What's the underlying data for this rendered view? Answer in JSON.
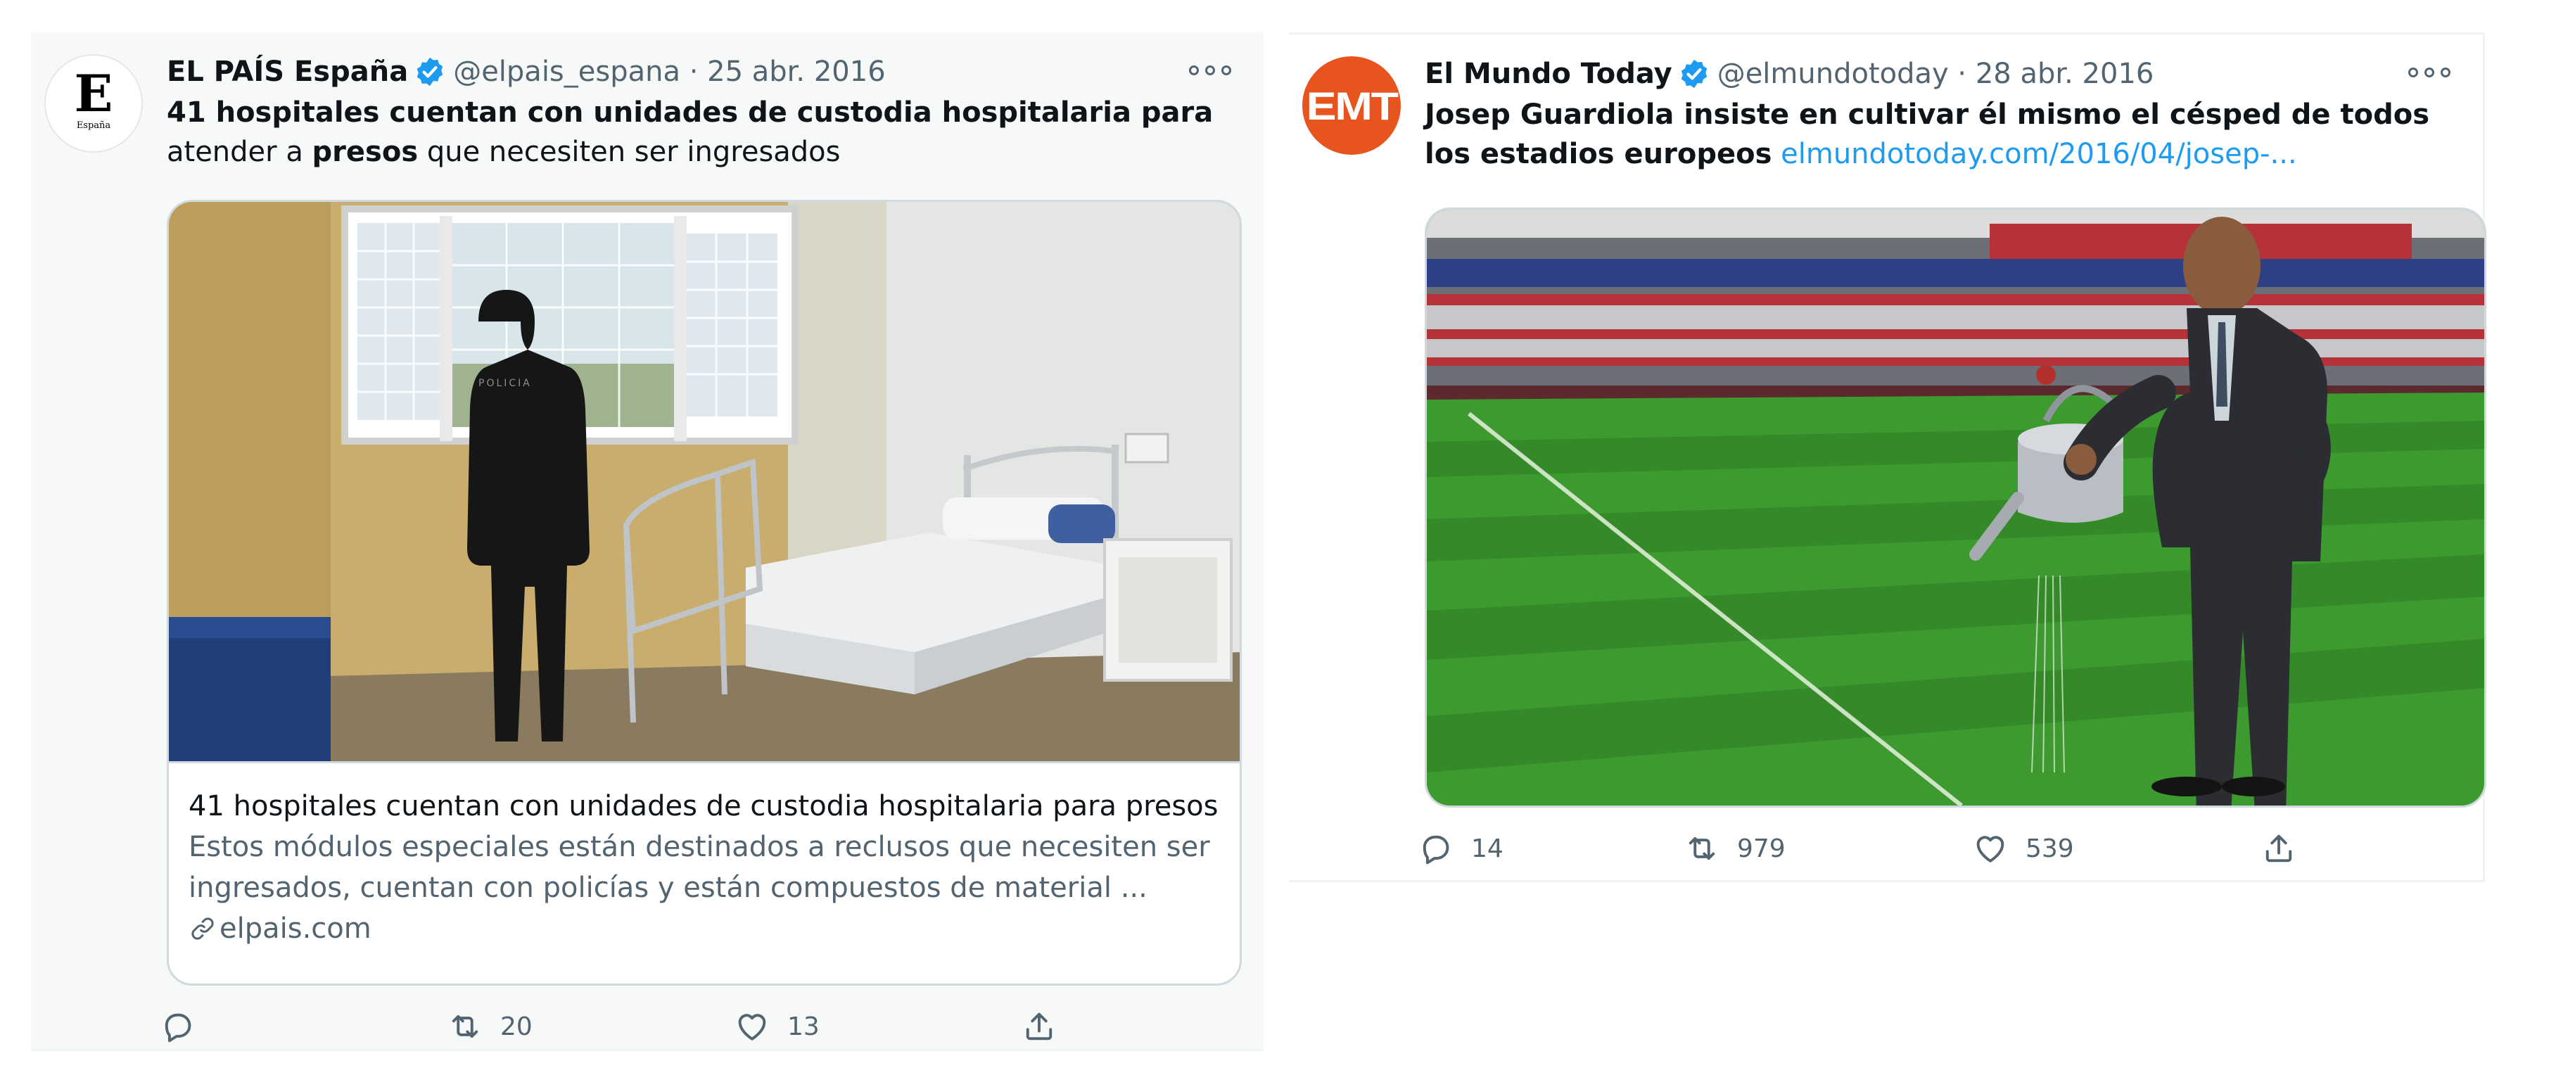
{
  "tweets": [
    {
      "author_name": "EL PAÍS España",
      "handle": "@elpais_espana",
      "date": "25 abr. 2016",
      "avatar_letter": "E",
      "avatar_sub": "España",
      "text_bold_1": "41 hospitales cuentan con unidades de custodia hospitalaria para",
      "text_plain_1": "atender a ",
      "text_bold_2": "presos",
      "text_plain_2": " que necesiten ser ingresados",
      "card": {
        "title": "41 hospitales cuentan con unidades de custodia hospitalaria para presos",
        "description": "Estos módulos especiales están destinados a reclusos que necesiten ser ingresados, cuentan con policías y están compuestos de material ...",
        "domain": "elpais.com",
        "image_alt": "Police officer standing by a window in a hospital custody room with a bed"
      },
      "replies": "",
      "retweets": "20",
      "likes": "13"
    },
    {
      "author_name": "El Mundo Today",
      "handle": "@elmundotoday",
      "date": "28 abr. 2016",
      "avatar_text": "EMT",
      "text_bold": "Josep Guardiola insiste en cultivar él mismo el césped de todos los estadios europeos",
      "text_link": "elmundotoday.com/2016/04/josep-...",
      "image_alt": "Man in a suit watering the grass of a football stadium with a watering can",
      "replies": "14",
      "retweets": "979",
      "likes": "539"
    }
  ],
  "colors": {
    "text_primary": "#0f1419",
    "text_secondary": "#536471",
    "link": "#1d9bf0",
    "verified": "#1d9bf0",
    "emt_brand": "#e8541e"
  }
}
